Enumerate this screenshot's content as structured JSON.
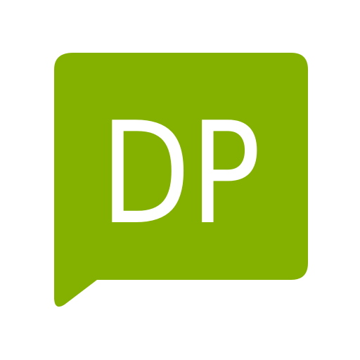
{
  "logo": {
    "text": "DP",
    "colors": {
      "bubble": "#84B100",
      "text": "#FFFFFF",
      "background": "#FFFFFF"
    },
    "icon": "speech-bubble-icon"
  }
}
